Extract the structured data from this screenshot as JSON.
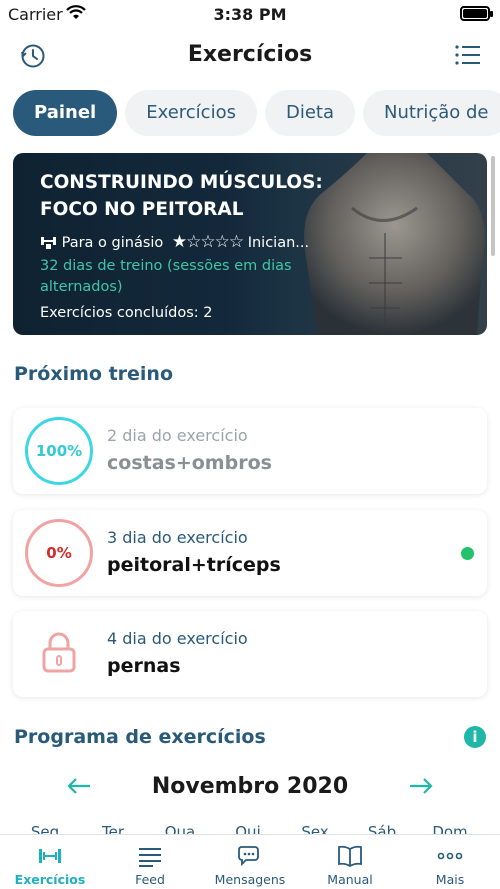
{
  "status": {
    "carrier": "Carrier",
    "time": "3:38 PM"
  },
  "nav": {
    "title": "Exercícios"
  },
  "tabs": [
    {
      "label": "Painel",
      "active": true
    },
    {
      "label": "Exercícios"
    },
    {
      "label": "Dieta"
    },
    {
      "label": "Nutrição de"
    }
  ],
  "hero": {
    "title": "CONSTRUINDO MÚSCULOS: FOCO NO PEITORAL",
    "place": "Para o ginásio",
    "level": "Inician...",
    "rating": 1,
    "rating_max": 5,
    "days": "32 dias de treino (sessões em dias alternados)",
    "done_label": "Exercícios concluídos:",
    "done_value": "2"
  },
  "next_workout": {
    "title": "Próximo treino",
    "items": [
      {
        "progress": "100%",
        "day": "2 dia do exercício",
        "name": "costas+ombros",
        "state": "done"
      },
      {
        "progress": "0%",
        "day": "3 dia do exercício",
        "name": "peitoral+tríceps",
        "state": "current"
      },
      {
        "progress": "",
        "day": "4 dia do exercício",
        "name": "pernas",
        "state": "locked"
      }
    ]
  },
  "program": {
    "title": "Programa de exercícios",
    "month": "Novembro 2020",
    "weekdays": [
      "Seg",
      "Ter",
      "Qua",
      "Qui",
      "Sex",
      "Sáb",
      "Dom"
    ]
  },
  "tabbar": [
    {
      "label": "Exercícios",
      "icon": "dumbbell-icon",
      "active": true
    },
    {
      "label": "Feed",
      "icon": "feed-icon"
    },
    {
      "label": "Mensagens",
      "icon": "chat-icon"
    },
    {
      "label": "Manual",
      "icon": "book-icon"
    },
    {
      "label": "Mais",
      "icon": "more-icon"
    }
  ],
  "colors": {
    "primary": "#295a7b",
    "accent": "#1fb0c0",
    "success": "#21c26b",
    "danger": "#d42a2a"
  }
}
